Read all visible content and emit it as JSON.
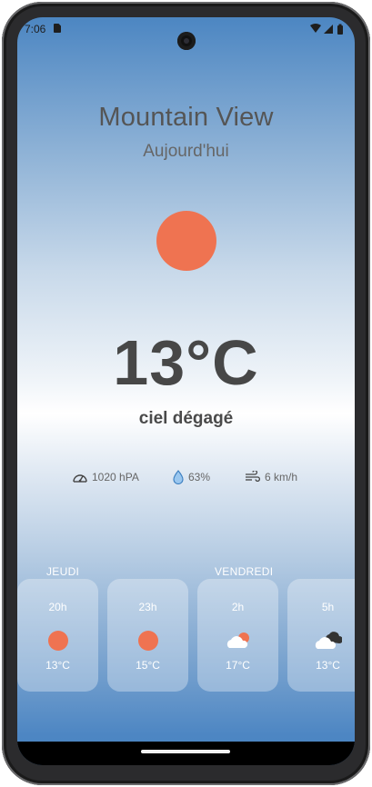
{
  "status_bar": {
    "time": "7:06",
    "icons": [
      "sim-card-icon",
      "wifi-icon",
      "signal-icon",
      "battery-icon"
    ]
  },
  "location": {
    "city": "Mountain View",
    "day": "Aujourd'hui"
  },
  "current": {
    "icon": "sun-icon",
    "temperature": "13°C",
    "description": "ciel dégagé"
  },
  "metrics": {
    "pressure": {
      "icon": "gauge-icon",
      "value": "1020 hPA"
    },
    "humidity": {
      "icon": "water-drop-icon",
      "value": "63%"
    },
    "wind": {
      "icon": "wind-icon",
      "value": "6 km/h"
    }
  },
  "forecast": {
    "day_labels": [
      "JEUDI",
      "VENDREDI"
    ],
    "hours": [
      {
        "hour": "20h",
        "icon": "sun-icon",
        "temp": "13°C"
      },
      {
        "hour": "23h",
        "icon": "sun-icon",
        "temp": "15°C"
      },
      {
        "hour": "2h",
        "icon": "cloud-sun-icon",
        "temp": "17°C"
      },
      {
        "hour": "5h",
        "icon": "cloud-icon",
        "temp": "13°C"
      }
    ]
  },
  "colors": {
    "sun": "#ef7351",
    "sky_top": "#4c86c2",
    "text": "#474747"
  }
}
